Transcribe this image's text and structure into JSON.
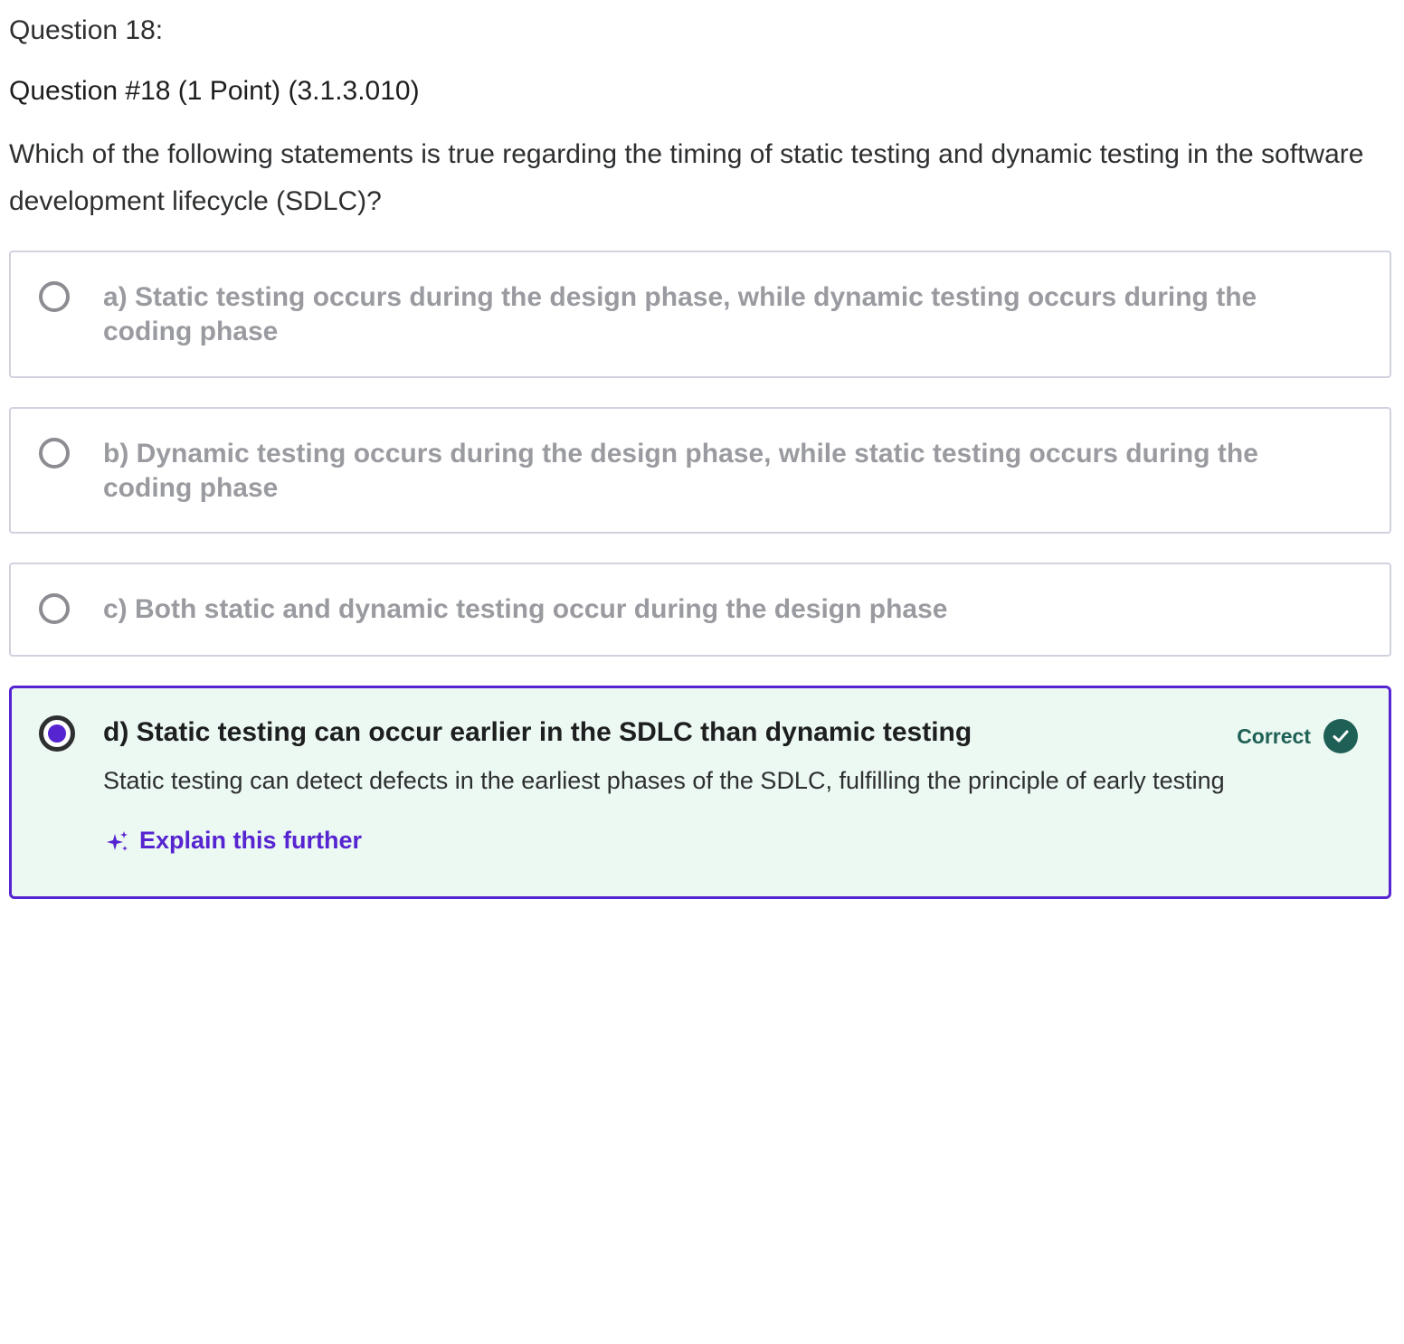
{
  "question": {
    "label": "Question 18:",
    "title": "Question #18 (1 Point) (3.1.3.010)",
    "prompt": "Which of the following statements is true regarding the timing of static testing and dynamic testing in the software development lifecycle (SDLC)?"
  },
  "options": [
    {
      "text": "a) Static testing occurs during the design phase, while dynamic testing occurs during the coding phase",
      "selected": false
    },
    {
      "text": "b) Dynamic testing occurs during the design phase, while static testing occurs during the coding phase",
      "selected": false
    },
    {
      "text": "c) Both static and dynamic testing occur during the design phase",
      "selected": false
    },
    {
      "text": "d) Static testing can occur earlier in the SDLC than dynamic testing",
      "selected": true,
      "status": "Correct",
      "explanation": "Static testing can detect defects in the earliest phases of the SDLC, fulfilling the principle of early testing",
      "explain_further_label": "Explain this further"
    }
  ],
  "icons": {
    "status_icon": "check-circle-icon",
    "explain_icon": "sparkle-icon"
  },
  "colors": {
    "accent": "#5624d0",
    "correct_green": "#1e6055",
    "selected_bg": "#ecf8f2",
    "unselected_text": "#9a9ba0"
  }
}
